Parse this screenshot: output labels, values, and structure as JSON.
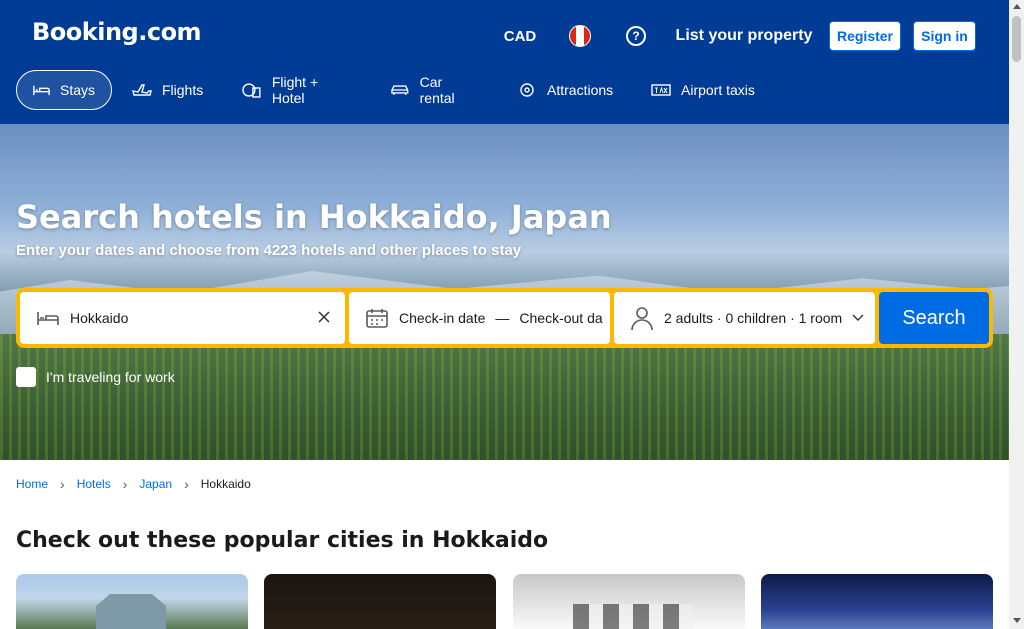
{
  "header": {
    "logo_text": "Booking.com",
    "currency": "CAD",
    "flag": "canada-flag",
    "help_icon": "question-icon",
    "list_property": "List your property",
    "register": "Register",
    "sign_in": "Sign in",
    "nav": [
      {
        "label": "Stays",
        "icon": "bed-icon",
        "active": true
      },
      {
        "label": "Flights",
        "icon": "plane-icon"
      },
      {
        "label": "Flight + Hotel",
        "icon": "plane-hotel-icon"
      },
      {
        "label": "Car rental",
        "icon": "car-icon"
      },
      {
        "label": "Attractions",
        "icon": "attractions-icon"
      },
      {
        "label": "Airport taxis",
        "icon": "taxi-icon"
      }
    ]
  },
  "hero": {
    "title": "Search hotels in Hokkaido, Japan",
    "subtitle": "Enter your dates and choose from 4223 hotels and other places to stay"
  },
  "search": {
    "destination_value": "Hokkaido",
    "check_in": "Check-in date",
    "dash": "—",
    "check_out": "Check-out da",
    "guests": "2 adults · 0 children · 1 room",
    "button": "Search",
    "work_label": "I'm traveling for work"
  },
  "breadcrumb": {
    "home": "Home",
    "hotels": "Hotels",
    "japan": "Japan",
    "current": "Hokkaido"
  },
  "section_title": "Check out these popular cities in Hokkaido",
  "colors": {
    "brand_blue": "#003b95",
    "action_blue": "#006ce4",
    "search_yellow": "#ffb700"
  }
}
